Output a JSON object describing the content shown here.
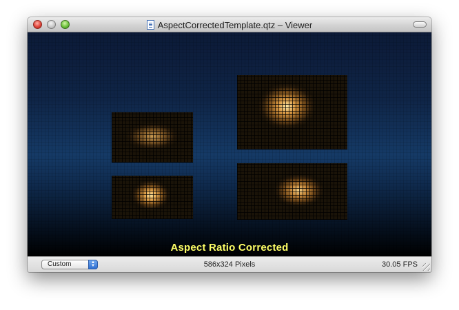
{
  "window": {
    "title": "AspectCorrectedTemplate.qtz – Viewer",
    "close_button": "close",
    "minimize_button": "minimize",
    "zoom_button": "zoom"
  },
  "viewer": {
    "caption": "Aspect Ratio Corrected",
    "caption_color": "#ffff66",
    "tiles": [
      {
        "name": "tile-top-left"
      },
      {
        "name": "tile-bottom-left"
      },
      {
        "name": "tile-top-right"
      },
      {
        "name": "tile-bottom-right"
      }
    ]
  },
  "statusbar": {
    "size_popup_value": "Custom",
    "dimensions": "586x324 Pixels",
    "fps": "30.05 FPS"
  },
  "icons": {
    "document": "document-icon",
    "popup_arrows": "up-down-arrows-icon",
    "resize": "resize-grip-icon",
    "toolbar": "toolbar-toggle-icon"
  }
}
